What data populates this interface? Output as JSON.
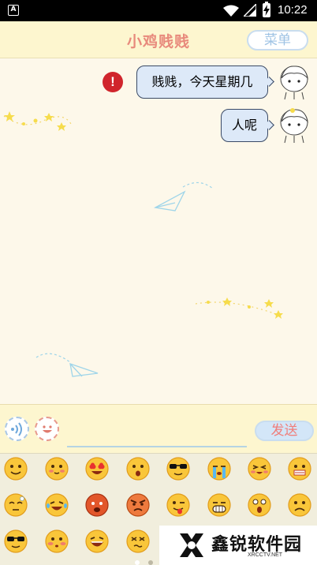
{
  "status_bar": {
    "left_icon_label": "A",
    "time": "10:22"
  },
  "header": {
    "title": "小鸡贱贱",
    "menu_label": "菜单"
  },
  "messages": [
    {
      "text": "贱贱，今天星期几",
      "from": "user",
      "failed": true
    },
    {
      "text": "人呢",
      "from": "user",
      "failed": false
    }
  ],
  "error_icon_glyph": "!",
  "input": {
    "value": "",
    "placeholder": "",
    "send_label": "发送"
  },
  "emoji_rows": [
    [
      "smile",
      "blush",
      "heart-eyes",
      "surprised",
      "sunglasses",
      "crying",
      "excited",
      "zipper-mouth"
    ],
    [
      "sleepy",
      "tears-of-joy",
      "angry-red",
      "furious",
      "tongue-out",
      "grin",
      "shocked",
      "frown"
    ],
    [
      "cool",
      "shy",
      "laughing",
      "dizzy"
    ]
  ],
  "pager": {
    "pages": 2,
    "current": 1
  },
  "watermark": {
    "title": "鑫锐软件园",
    "subtitle": "XRCCTV.NET"
  },
  "colors": {
    "header_bg": "#fdf6cf",
    "title": "#e88a7c",
    "bubble": "#dde9f8",
    "error": "#d0252c",
    "send_text": "#f07e7a"
  }
}
